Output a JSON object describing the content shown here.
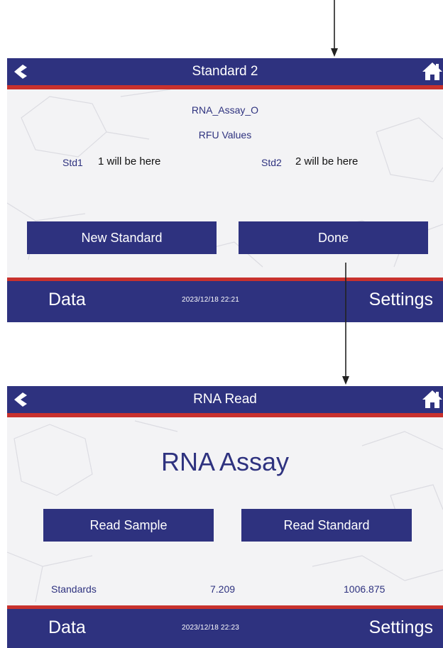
{
  "screen1": {
    "header": {
      "title": "Standard 2",
      "back_icon": "chevron-left-icon",
      "home_icon": "home-icon"
    },
    "assay_name": "RNA_Assay_O",
    "rfu_label": "RFU Values",
    "std1": {
      "label": "Std1",
      "value": "1 will be here"
    },
    "std2": {
      "label": "Std2",
      "value": "2 will be here"
    },
    "buttons": {
      "new_standard": "New Standard",
      "done": "Done"
    },
    "footer": {
      "left": "Data",
      "datetime": "2023/12/18   22:21",
      "right": "Settings"
    }
  },
  "screen2": {
    "header": {
      "title": "RNA Read",
      "back_icon": "chevron-left-icon",
      "home_icon": "home-icon"
    },
    "title": "RNA Assay",
    "buttons": {
      "read_sample": "Read Sample",
      "read_standard": "Read Standard"
    },
    "standards": {
      "label": "Standards",
      "value1": "7.209",
      "value2": "1006.875"
    },
    "footer": {
      "left": "Data",
      "datetime": "2023/12/18   22:23",
      "right": "Settings"
    }
  },
  "colors": {
    "primary": "#2e327f",
    "accent": "#c8312d",
    "background": "#f3f3f5"
  }
}
